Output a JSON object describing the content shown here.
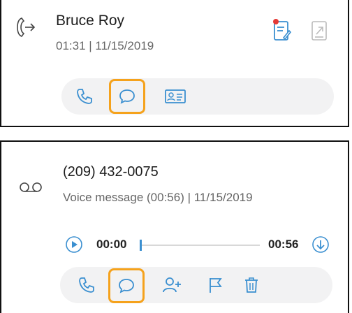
{
  "call_entry": {
    "name": "Bruce Roy",
    "meta": "01:31 | 11/15/2019",
    "icons": {
      "direction": "outgoing-call-icon",
      "note": "call-note-icon",
      "export": "export-icon"
    },
    "actions": [
      {
        "icon": "phone-icon"
      },
      {
        "icon": "chat-icon",
        "focused": true
      },
      {
        "icon": "contact-card-icon"
      }
    ]
  },
  "voicemail_entry": {
    "number": "(209) 432-0075",
    "meta": "Voice message (00:56) | 11/15/2019",
    "icons": {
      "type": "voicemail-icon"
    },
    "player": {
      "current_time": "00:00",
      "duration": "00:56",
      "progress": 0
    },
    "actions": [
      {
        "icon": "phone-icon"
      },
      {
        "icon": "chat-icon",
        "focused": true
      },
      {
        "icon": "add-contact-icon"
      },
      {
        "icon": "flag-icon"
      },
      {
        "icon": "delete-icon"
      }
    ]
  },
  "colors": {
    "accent": "#3a8fd0",
    "focus_ring": "#f5a21c",
    "note_dot": "#e53935",
    "pill_bg": "#f2f2f3"
  }
}
